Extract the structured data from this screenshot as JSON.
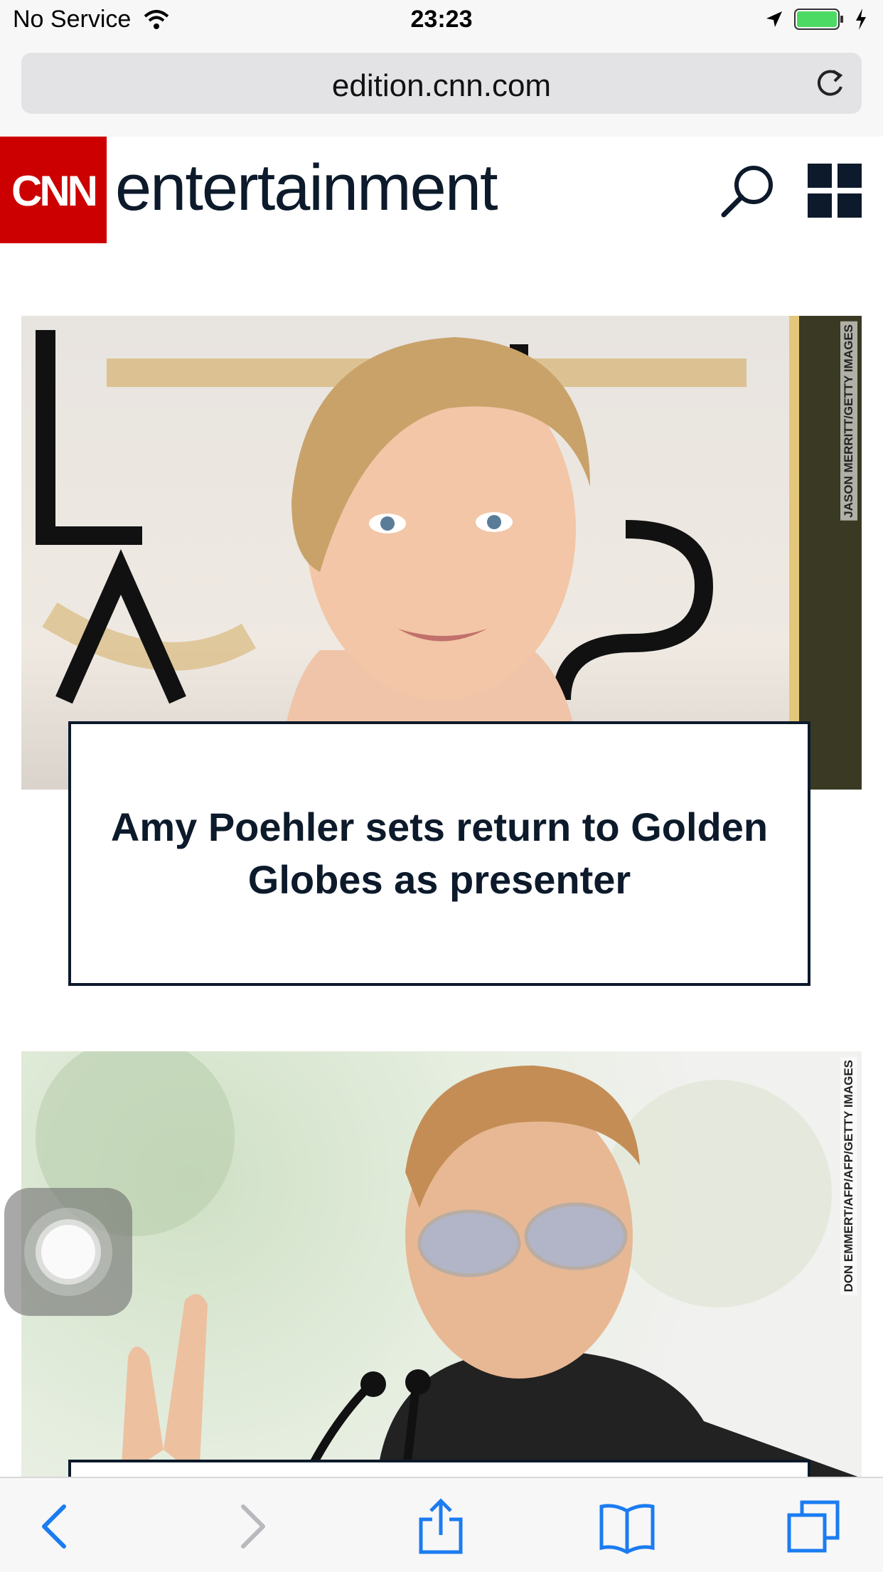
{
  "status_bar": {
    "carrier": "No Service",
    "time": "23:23",
    "icons": [
      "wifi-icon",
      "location-arrow-icon",
      "battery-icon",
      "charging-bolt-icon"
    ]
  },
  "browser": {
    "url": "edition.cnn.com",
    "toolbar_icons": [
      "back-icon",
      "forward-icon",
      "share-icon",
      "bookmarks-icon",
      "tabs-icon"
    ]
  },
  "site": {
    "logo_text": "CNN",
    "section": "entertainment",
    "brand_color": "#cc0000",
    "text_color": "#0c1a2b",
    "header_icons": [
      "search-icon",
      "menu-grid-icon"
    ]
  },
  "articles": [
    {
      "headline": "Amy Poehler sets return to Golden Globes as presenter",
      "photo_credit": "JASON MERRITT/GETTY IMAGES"
    },
    {
      "headline": "",
      "photo_credit": "DON EMMERT/AFP/AFP/GETTY IMAGES"
    }
  ]
}
